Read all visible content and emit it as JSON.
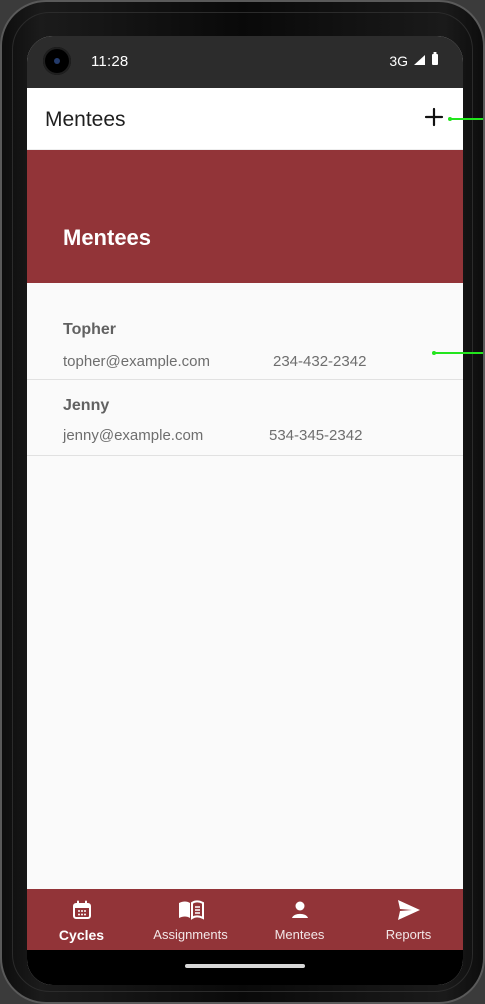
{
  "status_bar": {
    "time": "11:28",
    "network": "3G",
    "signal_icon": "signal-icon",
    "battery_icon": "battery-icon",
    "camera_icon": "front-camera-icon"
  },
  "app_bar": {
    "title": "Mentees",
    "add_icon": "plus-icon"
  },
  "hero": {
    "title": "Mentees"
  },
  "mentees": [
    {
      "name": "Topher",
      "email": "topher@example.com",
      "phone": "234-432-2342"
    },
    {
      "name": "Jenny",
      "email": "jenny@example.com",
      "phone": "534-345-2342"
    }
  ],
  "bottom_nav": {
    "items": [
      {
        "label": "Cycles",
        "icon": "calendar-icon",
        "active": true
      },
      {
        "label": "Assignments",
        "icon": "book-icon",
        "active": false
      },
      {
        "label": "Mentees",
        "icon": "person-icon",
        "active": false
      },
      {
        "label": "Reports",
        "icon": "send-icon",
        "active": false
      }
    ]
  },
  "colors": {
    "primary": "#923438",
    "background": "#fafafa",
    "callout": "#22e51d"
  }
}
